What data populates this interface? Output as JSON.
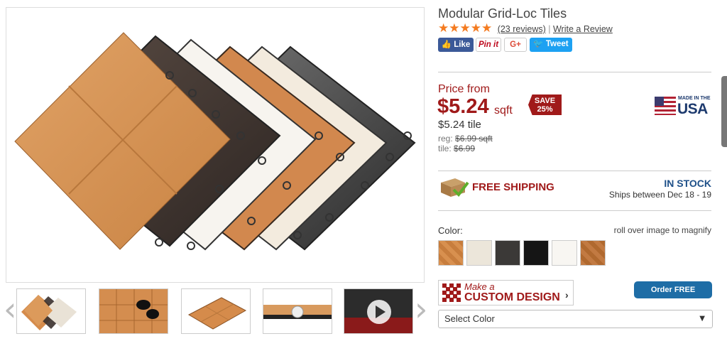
{
  "product": {
    "title": "Modular Grid-Loc Tiles",
    "stars": "★★★★★",
    "rating": 4.5,
    "reviews_link": "(23 reviews)",
    "write_review": "Write a Review"
  },
  "social": {
    "like": "Like",
    "pinit": "Pin it",
    "gplus": "G+",
    "tweet": "Tweet"
  },
  "price": {
    "from_label": "Price from",
    "amount": "$5.24",
    "unit": "sqft",
    "tile_price": "$5.24 tile",
    "reg_label": "reg:",
    "reg_value": "$6.99 sqft",
    "tile_label": "tile:",
    "tile_value": "$6.99",
    "save_line1": "SAVE",
    "save_line2": "25%"
  },
  "badge": {
    "made_in": "MADE IN THE",
    "country": "USA"
  },
  "shipping": {
    "free_label": "FREE SHIPPING",
    "stock": "IN STOCK",
    "dates": "Ships between Dec 18 - 19"
  },
  "color": {
    "label": "Color:",
    "hint": "roll over image to magnify",
    "swatch_icons": [
      "oak-swatch",
      "marble-swatch",
      "dark-stone-swatch",
      "black-swatch",
      "white-swatch",
      "cherry-swatch"
    ]
  },
  "custom_design": {
    "line1": "Make a",
    "line2": "CUSTOM DESIGN",
    "chevron": "›"
  },
  "order_samples": "Order FREE Samples",
  "select": {
    "value": "Select Color"
  },
  "colors": {
    "price_red": "#a01a1a",
    "star_orange": "#f47b20",
    "blue_button": "#1e6da6",
    "instock_blue": "#1d4f88"
  }
}
